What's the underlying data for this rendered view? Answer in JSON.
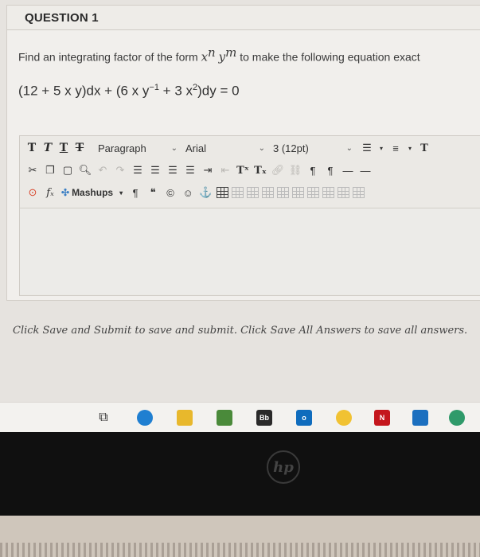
{
  "question": {
    "title": "QUESTION 1",
    "prompt_pre": "Find an integrating factor of the form ",
    "prompt_x": "x",
    "prompt_n": "n",
    "prompt_y": "y",
    "prompt_m": "m",
    "prompt_post": " to make the following equation exact",
    "eq_part1": "(12 + 5 x y)dx + (6 x y",
    "eq_exp1": "−1",
    "eq_part2": " + 3 x",
    "eq_exp2": "2",
    "eq_part3": ")dy = 0"
  },
  "toolbar": {
    "bold": "T",
    "italic": "T",
    "underline": "T",
    "strikethrough": "T",
    "paragraph": "Paragraph",
    "font": "Arial",
    "size": "3 (12pt)",
    "mashups": "Mashups"
  },
  "footer": {
    "note": "Click Save and Submit to save and submit. Click Save All Answers to save all answers."
  },
  "taskbar": {
    "bb_label": "Bb",
    "outlook_label": "o",
    "netflix_label": "N"
  },
  "laptop": {
    "brand": "hp"
  },
  "colors": {
    "edge_blue": "#1f7fd1",
    "chrome_yellow": "#f1c232",
    "netflix_red": "#c4161c",
    "outlook_blue": "#0f6cbd"
  }
}
